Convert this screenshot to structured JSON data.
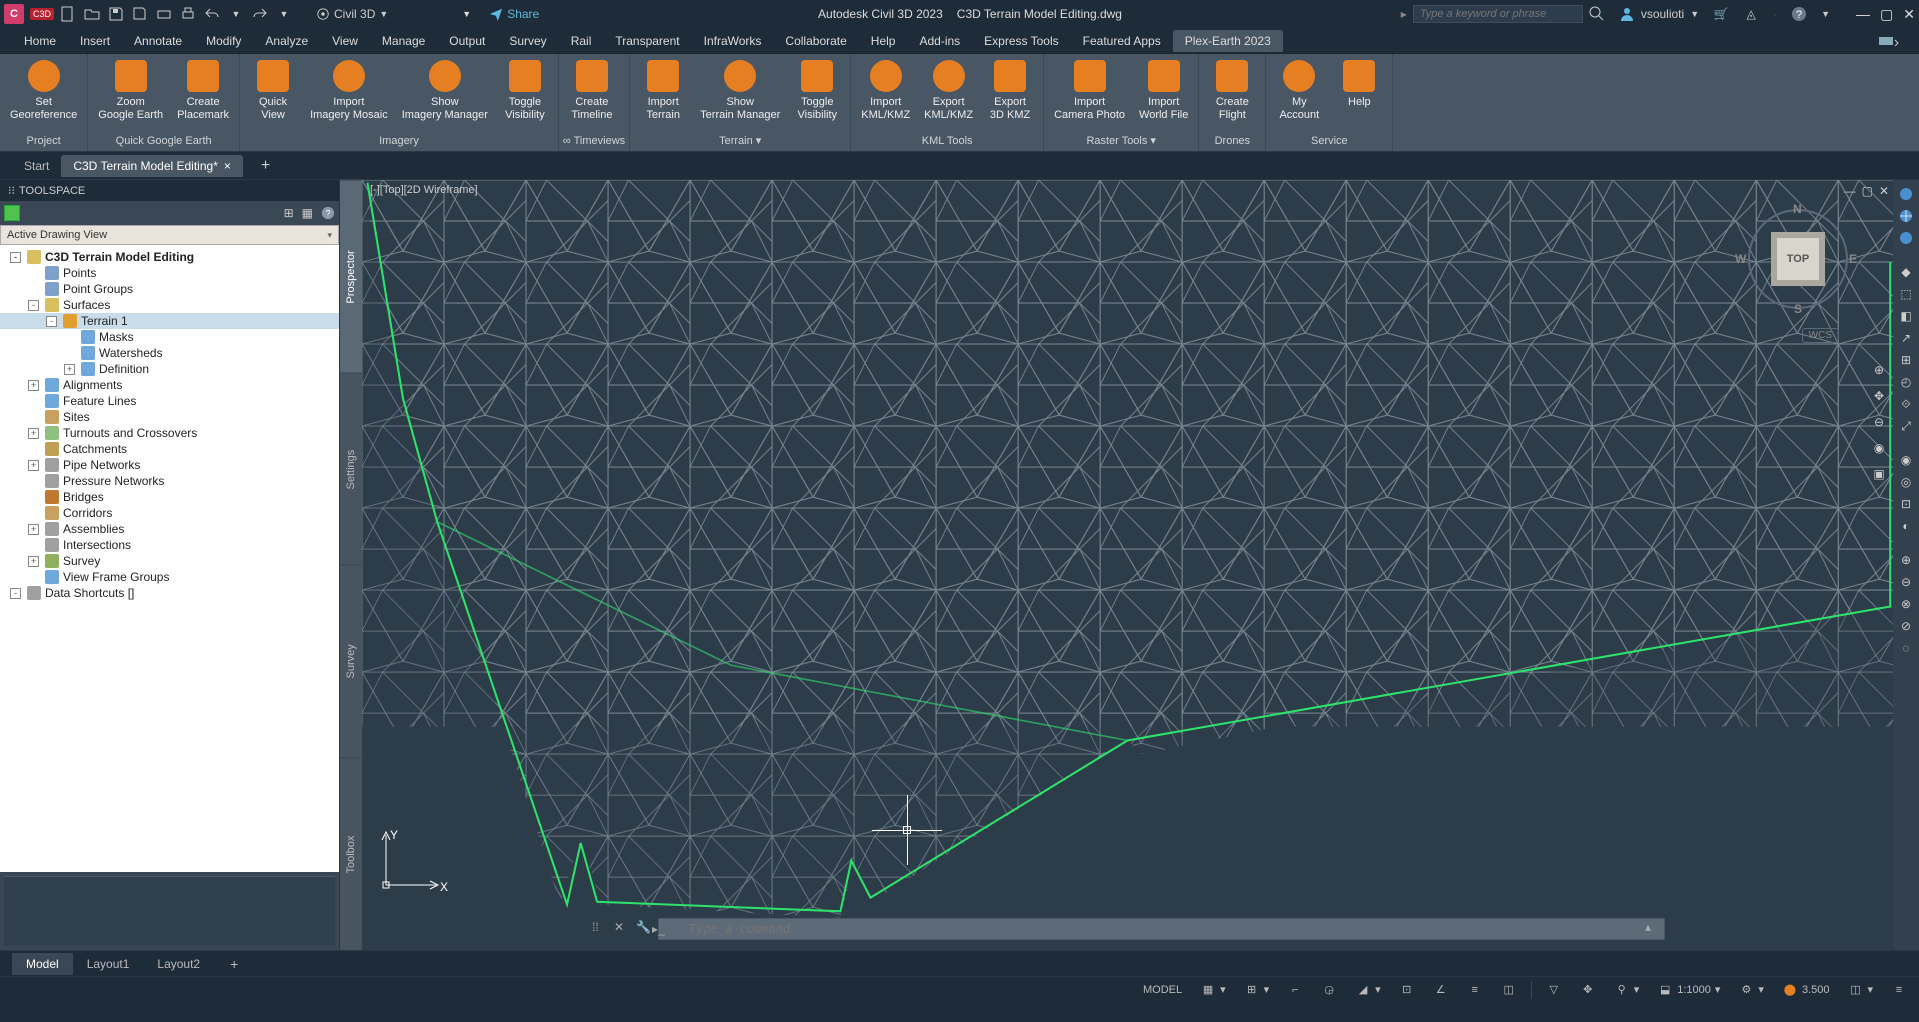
{
  "titlebar": {
    "logo": "C",
    "workspace": "Civil 3D",
    "share": "Share",
    "app_name": "Autodesk Civil 3D 2023",
    "doc_name": "C3D Terrain Model Editing.dwg",
    "search_placeholder": "Type a keyword or phrase",
    "username": "vsoulioti",
    "badge": "C3D"
  },
  "menubar": {
    "tabs": [
      "Home",
      "Insert",
      "Annotate",
      "Modify",
      "Analyze",
      "View",
      "Manage",
      "Output",
      "Survey",
      "Rail",
      "Transparent",
      "InfraWorks",
      "Collaborate",
      "Help",
      "Add-ins",
      "Express Tools",
      "Featured Apps",
      "Plex-Earth 2023"
    ],
    "active_index": 17
  },
  "ribbon": {
    "panels": [
      {
        "title": "Project",
        "buttons": [
          {
            "label": "Set Georeference"
          }
        ]
      },
      {
        "title": "Quick Google Earth",
        "buttons": [
          {
            "label": "Zoom Google Earth"
          },
          {
            "label": "Create Placemark"
          }
        ]
      },
      {
        "title": "Imagery",
        "buttons": [
          {
            "label": "Quick View"
          },
          {
            "label": "Import Imagery Mosaic"
          },
          {
            "label": "Show Imagery Manager"
          },
          {
            "label": "Toggle Visibility"
          }
        ]
      },
      {
        "title": "∞ Timeviews",
        "buttons": [
          {
            "label": "Create Timeline"
          }
        ]
      },
      {
        "title": "Terrain ▾",
        "buttons": [
          {
            "label": "Import Terrain"
          },
          {
            "label": "Show Terrain Manager"
          },
          {
            "label": "Toggle Visibility"
          }
        ]
      },
      {
        "title": "KML Tools",
        "buttons": [
          {
            "label": "Import KML/KMZ"
          },
          {
            "label": "Export KML/KMZ"
          },
          {
            "label": "Export 3D KMZ"
          }
        ]
      },
      {
        "title": "Raster Tools ▾",
        "buttons": [
          {
            "label": "Import Camera Photo"
          },
          {
            "label": "Import World File"
          }
        ]
      },
      {
        "title": "Drones",
        "buttons": [
          {
            "label": "Create Flight"
          }
        ]
      },
      {
        "title": "Service",
        "buttons": [
          {
            "label": "My Account"
          },
          {
            "label": "Help"
          }
        ]
      }
    ]
  },
  "doc_tabs": {
    "tabs": [
      {
        "label": "Start",
        "active": false
      },
      {
        "label": "C3D Terrain Model Editing*",
        "active": true
      }
    ]
  },
  "toolspace": {
    "title": "TOOLSPACE",
    "drawing_view": "Active Drawing View",
    "side_tabs": [
      "Prospector",
      "Settings",
      "Survey",
      "Toolbox"
    ],
    "side_active": 0,
    "tree": [
      {
        "lvl": 0,
        "exp": "-",
        "label": "C3D Terrain Model Editing",
        "bold": true,
        "icon": "#d8c060"
      },
      {
        "lvl": 1,
        "exp": "",
        "label": "Points",
        "icon": "#7fa0c8"
      },
      {
        "lvl": 1,
        "exp": "",
        "label": "Point Groups",
        "icon": "#7fa0c8"
      },
      {
        "lvl": 1,
        "exp": "-",
        "label": "Surfaces",
        "icon": "#d8c060"
      },
      {
        "lvl": 2,
        "exp": "-",
        "label": "Terrain 1",
        "selected": true,
        "icon": "#e0a030"
      },
      {
        "lvl": 3,
        "exp": "",
        "label": "Masks",
        "icon": "#6fa8dc"
      },
      {
        "lvl": 3,
        "exp": "",
        "label": "Watersheds",
        "icon": "#6fa8dc"
      },
      {
        "lvl": 3,
        "exp": "+",
        "label": "Definition",
        "icon": "#6fa8dc"
      },
      {
        "lvl": 1,
        "exp": "+",
        "label": "Alignments",
        "icon": "#6fa8dc"
      },
      {
        "lvl": 1,
        "exp": "",
        "label": "Feature Lines",
        "icon": "#6fa8dc"
      },
      {
        "lvl": 1,
        "exp": "",
        "label": "Sites",
        "icon": "#c8a060"
      },
      {
        "lvl": 1,
        "exp": "+",
        "label": "Turnouts and Crossovers",
        "icon": "#8fc080"
      },
      {
        "lvl": 1,
        "exp": "",
        "label": "Catchments",
        "icon": "#c0a050"
      },
      {
        "lvl": 1,
        "exp": "+",
        "label": "Pipe Networks",
        "icon": "#a0a0a0"
      },
      {
        "lvl": 1,
        "exp": "",
        "label": "Pressure Networks",
        "icon": "#a0a0a0"
      },
      {
        "lvl": 1,
        "exp": "",
        "label": "Bridges",
        "icon": "#c07830"
      },
      {
        "lvl": 1,
        "exp": "",
        "label": "Corridors",
        "icon": "#c8a060"
      },
      {
        "lvl": 1,
        "exp": "+",
        "label": "Assemblies",
        "icon": "#a0a0a0"
      },
      {
        "lvl": 1,
        "exp": "",
        "label": "Intersections",
        "icon": "#a0a0a0"
      },
      {
        "lvl": 1,
        "exp": "+",
        "label": "Survey",
        "icon": "#90b060"
      },
      {
        "lvl": 1,
        "exp": "",
        "label": "View Frame Groups",
        "icon": "#6fa8dc"
      },
      {
        "lvl": 0,
        "exp": "-",
        "label": "Data Shortcuts []",
        "icon": "#a0a0a0"
      }
    ]
  },
  "viewport": {
    "label": "[-][Top][2D Wireframe]",
    "wcs": "WCS",
    "viewcube_face": "TOP",
    "dirs": {
      "n": "N",
      "s": "S",
      "e": "E",
      "w": "W"
    },
    "ucs_x": "X",
    "ucs_y": "Y"
  },
  "cmdline": {
    "placeholder": "Type a command"
  },
  "layout_tabs": {
    "tabs": [
      "Model",
      "Layout1",
      "Layout2"
    ],
    "active_index": 0
  },
  "statusbar": {
    "model_label": "MODEL",
    "scale": "1:1000",
    "decimal": "3.500"
  }
}
